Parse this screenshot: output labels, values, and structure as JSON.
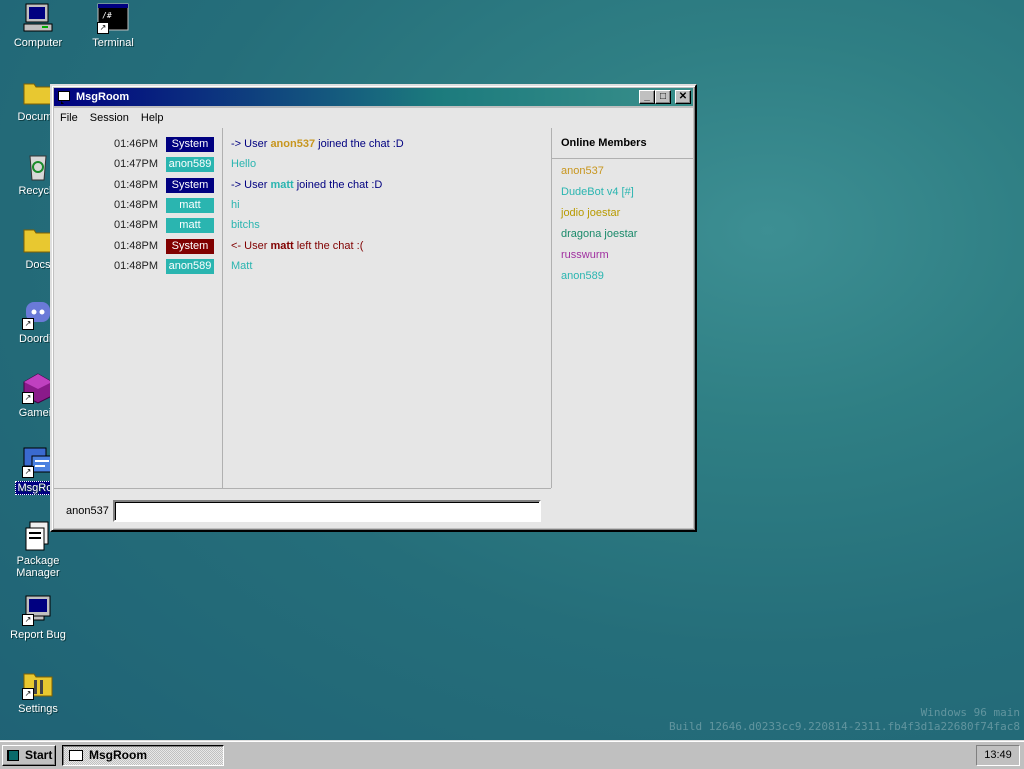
{
  "desktop": {
    "icons": [
      {
        "label": "Computer",
        "icon": "computer-icon"
      },
      {
        "label": "Terminal",
        "icon": "terminal-icon"
      },
      {
        "label": "Docume",
        "icon": "folder-icon"
      },
      {
        "label": "Recycle",
        "icon": "recycle-bin-icon"
      },
      {
        "label": "Docs",
        "icon": "folder-icon"
      },
      {
        "label": "Doordis",
        "icon": "discord-icon"
      },
      {
        "label": "Gamein",
        "icon": "game-icon"
      },
      {
        "label": "MsgRoo",
        "icon": "msgroom-icon"
      },
      {
        "label": "Package Manager",
        "icon": "package-icon"
      },
      {
        "label": "Report Bug",
        "icon": "report-bug-icon"
      },
      {
        "label": "Settings",
        "icon": "settings-icon"
      }
    ],
    "watermark_line1": "Windows 96 main",
    "watermark_line2": "Build 12646.d0233cc9.220814-2311.fb4f3d1a22680f74fac8"
  },
  "window": {
    "title": "MsgRoom",
    "minimize": "_",
    "maximize": "□",
    "close": "✕",
    "menu": [
      "File",
      "Session",
      "Help"
    ]
  },
  "colors": {
    "system_badge": "#000080",
    "system_leave_badge": "#800000",
    "anon589": "#2ab5b0",
    "anon537": "#c8961e",
    "matt": "#2ab5b0",
    "join_text": "#000080",
    "leave_text": "#800000"
  },
  "messages": [
    {
      "time": "01:46PM",
      "user": "System",
      "badge_color": "#000080",
      "prefix": "-> User ",
      "name": "anon537",
      "name_color": "#c8961e",
      "suffix": " joined the chat :D",
      "text_color": "#000080"
    },
    {
      "time": "01:47PM",
      "user": "anon589",
      "badge_color": "#2ab5b0",
      "prefix": "Hello",
      "name": "",
      "name_color": "#2ab5b0",
      "suffix": "",
      "text_color": "#2ab5b0"
    },
    {
      "time": "01:48PM",
      "user": "System",
      "badge_color": "#000080",
      "prefix": "-> User ",
      "name": "matt",
      "name_color": "#2ab5b0",
      "suffix": " joined the chat :D",
      "text_color": "#000080"
    },
    {
      "time": "01:48PM",
      "user": "matt",
      "badge_color": "#2ab5b0",
      "prefix": "hi",
      "name": "",
      "name_color": "#2ab5b0",
      "suffix": "",
      "text_color": "#2ab5b0"
    },
    {
      "time": "01:48PM",
      "user": "matt",
      "badge_color": "#2ab5b0",
      "prefix": "bitchs",
      "name": "",
      "name_color": "#2ab5b0",
      "suffix": "",
      "text_color": "#2ab5b0"
    },
    {
      "time": "01:48PM",
      "user": "System",
      "badge_color": "#800000",
      "prefix": "<- User ",
      "name": "matt",
      "name_color": "#800000",
      "suffix": " left the chat :(",
      "text_color": "#800000"
    },
    {
      "time": "01:48PM",
      "user": "anon589",
      "badge_color": "#2ab5b0",
      "prefix": "Matt",
      "name": "",
      "name_color": "#2ab5b0",
      "suffix": "",
      "text_color": "#2ab5b0"
    }
  ],
  "members": {
    "title": "Online Members",
    "list": [
      {
        "name": "anon537",
        "color": "#c8961e"
      },
      {
        "name": "DudeBot v4 [#]",
        "color": "#2ab5b0"
      },
      {
        "name": "jodio joestar",
        "color": "#b89a00"
      },
      {
        "name": "dragona joestar",
        "color": "#1a8a6a"
      },
      {
        "name": "russwurm",
        "color": "#a030a0"
      },
      {
        "name": "anon589",
        "color": "#2ab5b0"
      }
    ]
  },
  "input": {
    "nickname": "anon537",
    "value": ""
  },
  "taskbar": {
    "start_label": "Start",
    "task_label": "MsgRoom",
    "clock": "13:49"
  }
}
